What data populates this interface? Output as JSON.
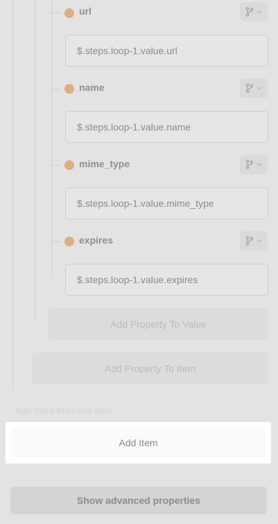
{
  "properties": [
    {
      "name": "url",
      "value": "$.steps.loop-1.value.url"
    },
    {
      "name": "name",
      "value": "$.steps.loop-1.value.name"
    },
    {
      "name": "mime_type",
      "value": "$.steps.loop-1.value.mime_type"
    },
    {
      "name": "expires",
      "value": "$.steps.loop-1.value.expires"
    }
  ],
  "type_icon": "branch-icon",
  "dropdown_icon": "chevron-down-icon",
  "add_property_to_value_label": "Add Property To Value",
  "add_property_to_item_label": "Add Property To Item",
  "hint_text": "Add more than one Item",
  "add_item_label": "Add Item",
  "advanced_label": "Show advanced properties",
  "colors": {
    "property_dot": "#dcae80",
    "background": "#e3e3e3"
  }
}
